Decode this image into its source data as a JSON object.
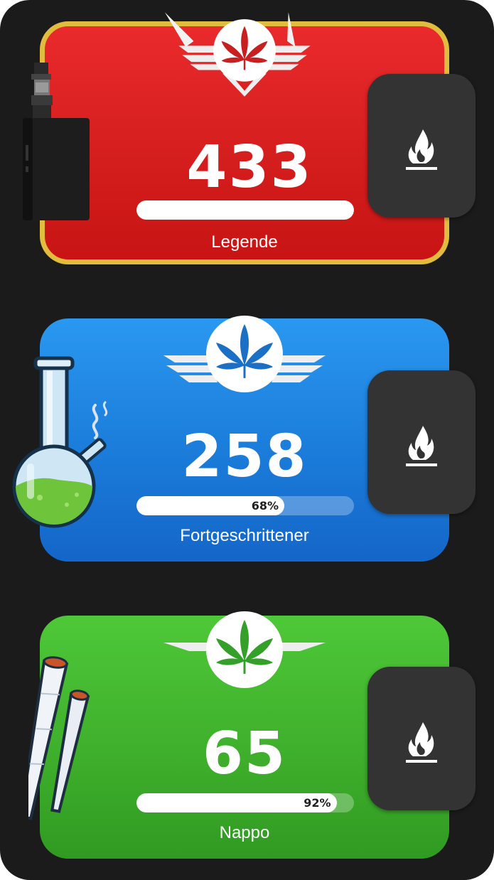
{
  "ranks": [
    {
      "count": "433",
      "title": "Legende",
      "progress_label": "",
      "progress_percent": 100,
      "theme_color": "#e02424",
      "border_color": "#e2bc3c",
      "leaf_color": "#c82020",
      "item_icon": "vape-mod-icon"
    },
    {
      "count": "258",
      "title": "Fortgeschrittener",
      "progress_label": "68%",
      "progress_percent": 68,
      "theme_color": "#1e86e0",
      "leaf_color": "#1b6fc4",
      "item_icon": "bong-icon"
    },
    {
      "count": "65",
      "title": "Nappo",
      "progress_label": "92%",
      "progress_percent": 92,
      "theme_color": "#44b830",
      "leaf_color": "#34a02a",
      "item_icon": "joint-icon"
    }
  ],
  "action_button_icon": "flame-icon",
  "background_color": "#1b1b1b"
}
